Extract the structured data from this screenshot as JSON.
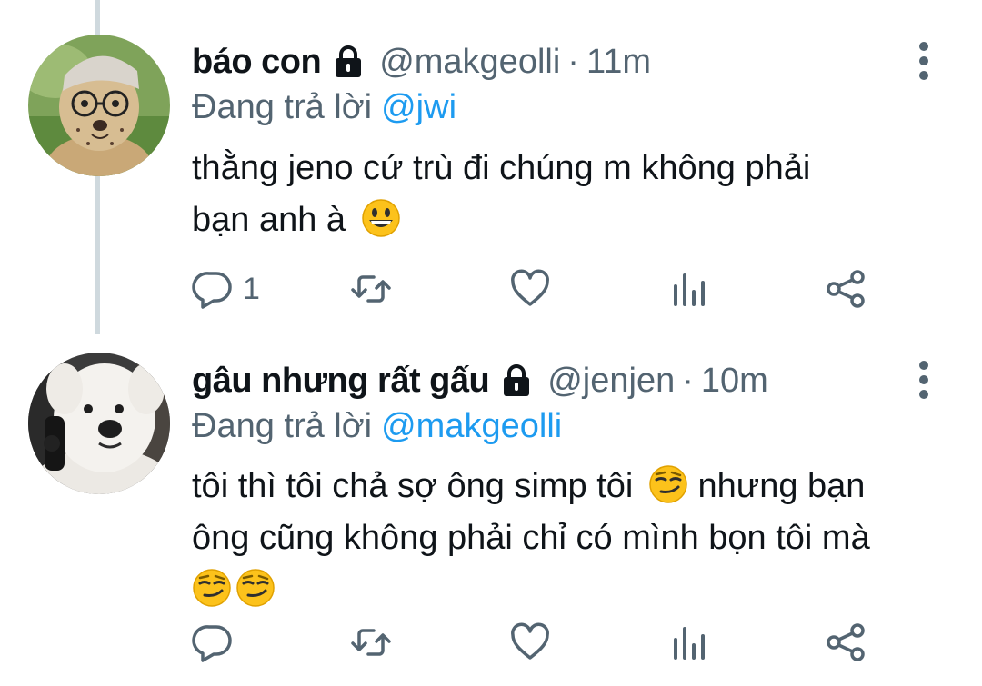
{
  "tweets": [
    {
      "display_name": "báo con",
      "handle": "@makgeolli",
      "separator": "·",
      "time": "11m",
      "reply_prefix": "Đang trả lời",
      "reply_mention": "@jwi",
      "text_line1": "thằng jeno cứ trù đi chúng m không phải",
      "text_line2": "bạn anh à",
      "emojis": [
        "grinning-face"
      ],
      "reply_count": "1",
      "avatar": "cheetah-cub-with-glasses"
    },
    {
      "display_name": "gâu nhưng rất gấu",
      "handle": "@jenjen",
      "separator": "·",
      "time": "10m",
      "reply_prefix": "Đang trả lời",
      "reply_mention": "@makgeolli",
      "text_line1": "tôi thì tôi chả sợ ông simp tôi",
      "text_line1b": "nhưng bạn",
      "text_line2": "ông cũng không phải chỉ có mình bọn tôi mà",
      "emojis": [
        "smirking-face",
        "smirking-face",
        "smirking-face"
      ],
      "reply_count": "",
      "avatar": "white-fluffy-dog"
    }
  ],
  "icons": {
    "lock": "lock-icon",
    "more": "vertical-dots-icon",
    "reply": "reply-icon",
    "retweet": "retweet-icon",
    "like": "heart-icon",
    "views": "analytics-icon",
    "share": "share-icon"
  },
  "colors": {
    "text": "#0f1419",
    "muted": "#536471",
    "link": "#1d9bf0",
    "thread_line": "#cfd9de"
  }
}
